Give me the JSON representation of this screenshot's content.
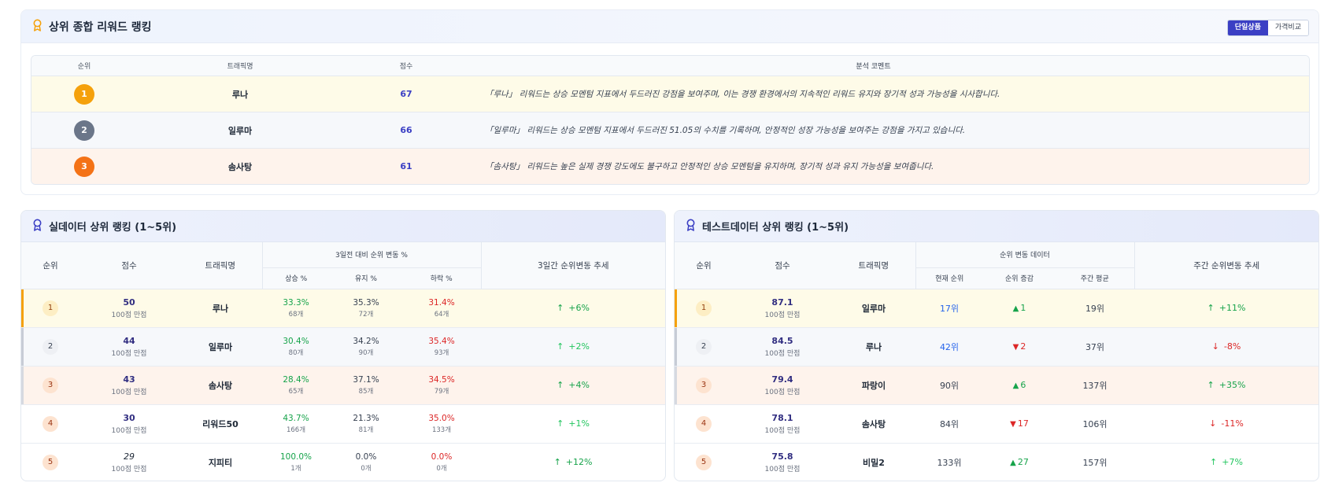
{
  "summary": {
    "title": "상위 종합 리워드 랭킹",
    "toggle": {
      "active": "단일상품",
      "inactive": "가격비교"
    },
    "headers": {
      "rank": "순위",
      "name": "트래픽명",
      "score": "점수",
      "comment": "분석 코멘트"
    },
    "rows": [
      {
        "rank": "1",
        "name": "루나",
        "score": "67",
        "comment": "「루나」 리워드는 상승 모멘텀 지표에서 두드러진 강점을 보여주며, 이는 경쟁 환경에서의 지속적인 리워드 유지와 장기적 성과 가능성을 시사합니다."
      },
      {
        "rank": "2",
        "name": "일루마",
        "score": "66",
        "comment": "「일루마」 리워드는 상승 모멘텀 지표에서 두드러진 51.05의 수치를 기록하며, 안정적인 성장 가능성을 보여주는 강점을 가지고 있습니다."
      },
      {
        "rank": "3",
        "name": "솜사탕",
        "score": "61",
        "comment": "「솜사탕」 리워드는 높은 실제 경쟁 강도에도 불구하고 안정적인 상승 모멘텀을 유지하며, 장기적 성과 유지 가능성을 보여줍니다."
      }
    ]
  },
  "real": {
    "title": "실데이터 상위 랭킹 (1~5위)",
    "headers": {
      "rank": "순위",
      "score": "점수",
      "name": "트래픽명",
      "group": "3일전 대비 순위 변동 %",
      "up": "상승 %",
      "keep": "유지 %",
      "down": "하락 %",
      "trend": "3일간 순위변동 추세"
    },
    "rows": [
      {
        "rank": "1",
        "score": "50",
        "score_sub": "100점 만점",
        "name": "루나",
        "up": "33.3%",
        "up_cnt": "68개",
        "keep": "35.3%",
        "keep_cnt": "72개",
        "down": "31.4%",
        "down_cnt": "64개",
        "trend": "+6%"
      },
      {
        "rank": "2",
        "score": "44",
        "score_sub": "100점 만점",
        "name": "일루마",
        "up": "30.4%",
        "up_cnt": "80개",
        "keep": "34.2%",
        "keep_cnt": "90개",
        "down": "35.4%",
        "down_cnt": "93개",
        "trend": "+2%"
      },
      {
        "rank": "3",
        "score": "43",
        "score_sub": "100점 만점",
        "name": "솜사탕",
        "up": "28.4%",
        "up_cnt": "65개",
        "keep": "37.1%",
        "keep_cnt": "85개",
        "down": "34.5%",
        "down_cnt": "79개",
        "trend": "+4%"
      },
      {
        "rank": "4",
        "score": "30",
        "score_sub": "100점 만점",
        "name": "리워드50",
        "up": "43.7%",
        "up_cnt": "166개",
        "keep": "21.3%",
        "keep_cnt": "81개",
        "down": "35.0%",
        "down_cnt": "133개",
        "trend": "+1%"
      },
      {
        "rank": "5",
        "score": "29",
        "score_sub": "100점 만점",
        "name": "지피티",
        "up": "100.0%",
        "up_cnt": "1개",
        "keep": "0.0%",
        "keep_cnt": "0개",
        "down": "0.0%",
        "down_cnt": "0개",
        "trend": "+12%"
      }
    ]
  },
  "test": {
    "title": "테스트데이터 상위 랭킹 (1~5위)",
    "headers": {
      "rank": "순위",
      "score": "점수",
      "name": "트래픽명",
      "group": "순위 변동 데이터",
      "current": "현재 순위",
      "change": "순위 증감",
      "weekly": "주간 평균",
      "trend": "주간 순위변동 추세"
    },
    "rows": [
      {
        "rank": "1",
        "score": "87.1",
        "score_sub": "100점 만점",
        "name": "일루마",
        "current": "17위",
        "change": "1",
        "dir": "up",
        "weekly": "19위",
        "trend": "+11%"
      },
      {
        "rank": "2",
        "score": "84.5",
        "score_sub": "100점 만점",
        "name": "루나",
        "current": "42위",
        "change": "2",
        "dir": "down",
        "weekly": "37위",
        "trend": "-8%"
      },
      {
        "rank": "3",
        "score": "79.4",
        "score_sub": "100점 만점",
        "name": "파랑이",
        "current": "90위",
        "change": "6",
        "dir": "up",
        "weekly": "137위",
        "trend": "+35%"
      },
      {
        "rank": "4",
        "score": "78.1",
        "score_sub": "100점 만점",
        "name": "솜사탕",
        "current": "84위",
        "change": "17",
        "dir": "down",
        "weekly": "106위",
        "trend": "-11%"
      },
      {
        "rank": "5",
        "score": "75.8",
        "score_sub": "100점 만점",
        "name": "비밀2",
        "current": "133위",
        "change": "27",
        "dir": "up",
        "weekly": "157위",
        "trend": "+7%"
      }
    ]
  },
  "icons": {
    "title_icon": "award-ribbon-icon",
    "up": "arrow-up-icon",
    "down": "arrow-down-icon"
  },
  "colors": {
    "brand": "#3b3fc4",
    "gold": "#f5a10b",
    "silver": "#6b7689",
    "bronze": "#f47216",
    "up": "#16a34a",
    "down": "#dc2626"
  }
}
